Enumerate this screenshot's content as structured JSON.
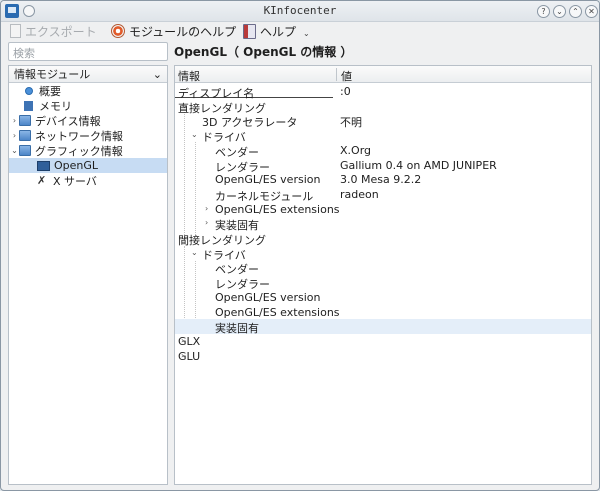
{
  "window": {
    "title": "KInfocenter"
  },
  "window_buttons": [
    "?",
    "⌄",
    "⌃",
    "✕"
  ],
  "toolbar": {
    "export_label": "エクスポート",
    "module_help_label": "モジュールのヘルプ",
    "help_label": "ヘルプ"
  },
  "search": {
    "placeholder": "検索"
  },
  "sidebar": {
    "header": "情報モジュール",
    "items": [
      {
        "label": "概要",
        "icon": "info-icon",
        "expandable": false
      },
      {
        "label": "メモリ",
        "icon": "memory-icon",
        "expandable": false
      },
      {
        "label": "デバイス情報",
        "icon": "folder-icon",
        "expandable": true,
        "expanded": false
      },
      {
        "label": "ネットワーク情報",
        "icon": "folder-icon",
        "expandable": true,
        "expanded": false
      },
      {
        "label": "グラフィック情報",
        "icon": "folder-icon",
        "expandable": true,
        "expanded": true
      },
      {
        "label": "OpenGL",
        "icon": "monitor-icon",
        "expandable": false,
        "selected": true
      },
      {
        "label": "X サーバ",
        "icon": "x-icon",
        "expandable": false
      }
    ]
  },
  "main": {
    "title": "OpenGL（ OpenGL の情報 ）",
    "columns": [
      "情報",
      "値"
    ],
    "rows": [
      {
        "key": "ディスプレイ名",
        "value": ":0",
        "depth": 0,
        "arrow": ""
      },
      {
        "key": "直接レンダリング",
        "value": "",
        "depth": 0,
        "arrow": "expanded"
      },
      {
        "key": "3D アクセラレータ",
        "value": "不明",
        "depth": 1,
        "arrow": ""
      },
      {
        "key": "ドライバ",
        "value": "",
        "depth": 1,
        "arrow": "expanded"
      },
      {
        "key": "ベンダー",
        "value": "X.Org",
        "depth": 2,
        "arrow": ""
      },
      {
        "key": "レンダラー",
        "value": "Gallium 0.4 on AMD JUNIPER",
        "depth": 2,
        "arrow": ""
      },
      {
        "key": "OpenGL/ES version",
        "value": "3.0 Mesa 9.2.2",
        "depth": 2,
        "arrow": ""
      },
      {
        "key": "カーネルモジュール",
        "value": "radeon",
        "depth": 2,
        "arrow": ""
      },
      {
        "key": "OpenGL/ES extensions",
        "value": "",
        "depth": 2,
        "arrow": "collapsed"
      },
      {
        "key": "実装固有",
        "value": "",
        "depth": 2,
        "arrow": "collapsed"
      },
      {
        "key": "間接レンダリング",
        "value": "",
        "depth": 0,
        "arrow": "expanded"
      },
      {
        "key": "ドライバ",
        "value": "",
        "depth": 1,
        "arrow": "expanded"
      },
      {
        "key": "ベンダー",
        "value": "",
        "depth": 2,
        "arrow": ""
      },
      {
        "key": "レンダラー",
        "value": "",
        "depth": 2,
        "arrow": ""
      },
      {
        "key": "OpenGL/ES version",
        "value": "",
        "depth": 2,
        "arrow": ""
      },
      {
        "key": "OpenGL/ES extensions",
        "value": "",
        "depth": 2,
        "arrow": ""
      },
      {
        "key": "実装固有",
        "value": "",
        "depth": 2,
        "arrow": "",
        "highlighted": true
      },
      {
        "key": "GLX",
        "value": "",
        "depth": 0,
        "arrow": "collapsed"
      },
      {
        "key": "GLU",
        "value": "",
        "depth": 0,
        "arrow": "collapsed"
      }
    ]
  }
}
